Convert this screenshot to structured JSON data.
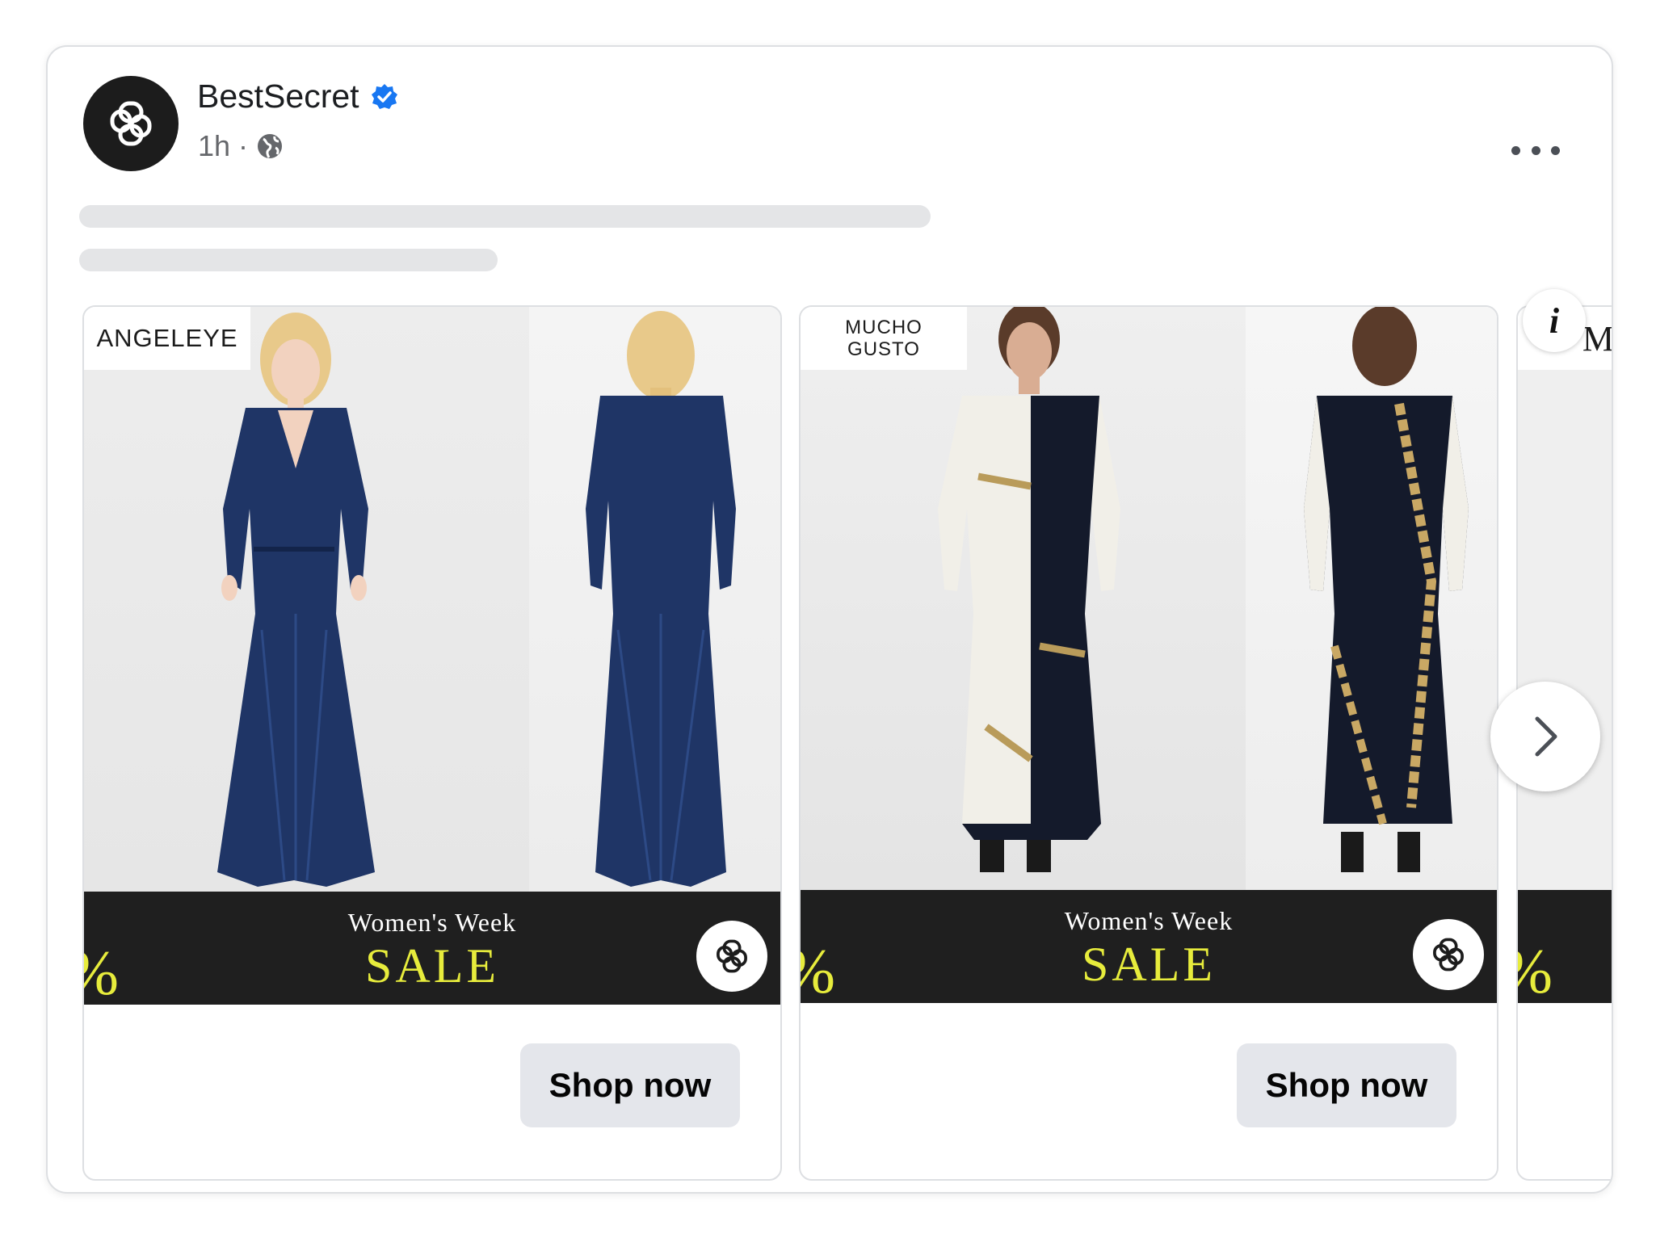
{
  "post": {
    "page_name": "BestSecret",
    "verified": true,
    "timestamp": "1h",
    "separator": "·",
    "audience_icon": "globe-icon",
    "more_icon": "more-horizontal-icon"
  },
  "carousel": {
    "cards": [
      {
        "brand": "ANGELEYE",
        "product": "navy sequin long-sleeve maxi dress",
        "banner_title": "Women's Week",
        "banner_sale": "SALE",
        "banner_pct": "%",
        "cta": "Shop now"
      },
      {
        "brand_line1": "MUCHO",
        "brand_line2": "GUSTO",
        "product": "printed shirt maxi dress",
        "banner_title": "Women's Week",
        "banner_sale": "SALE",
        "banner_pct": "%",
        "cta": "Shop now"
      },
      {
        "brand_partial": "M",
        "banner_pct": "%"
      }
    ],
    "next_icon": "chevron-right-icon",
    "info_label": "i"
  },
  "colors": {
    "banner_bg": "#1f1f1f",
    "sale_yellow": "#e7ec3c",
    "verified_blue": "#1877f2",
    "button_bg": "#e4e6eb"
  }
}
